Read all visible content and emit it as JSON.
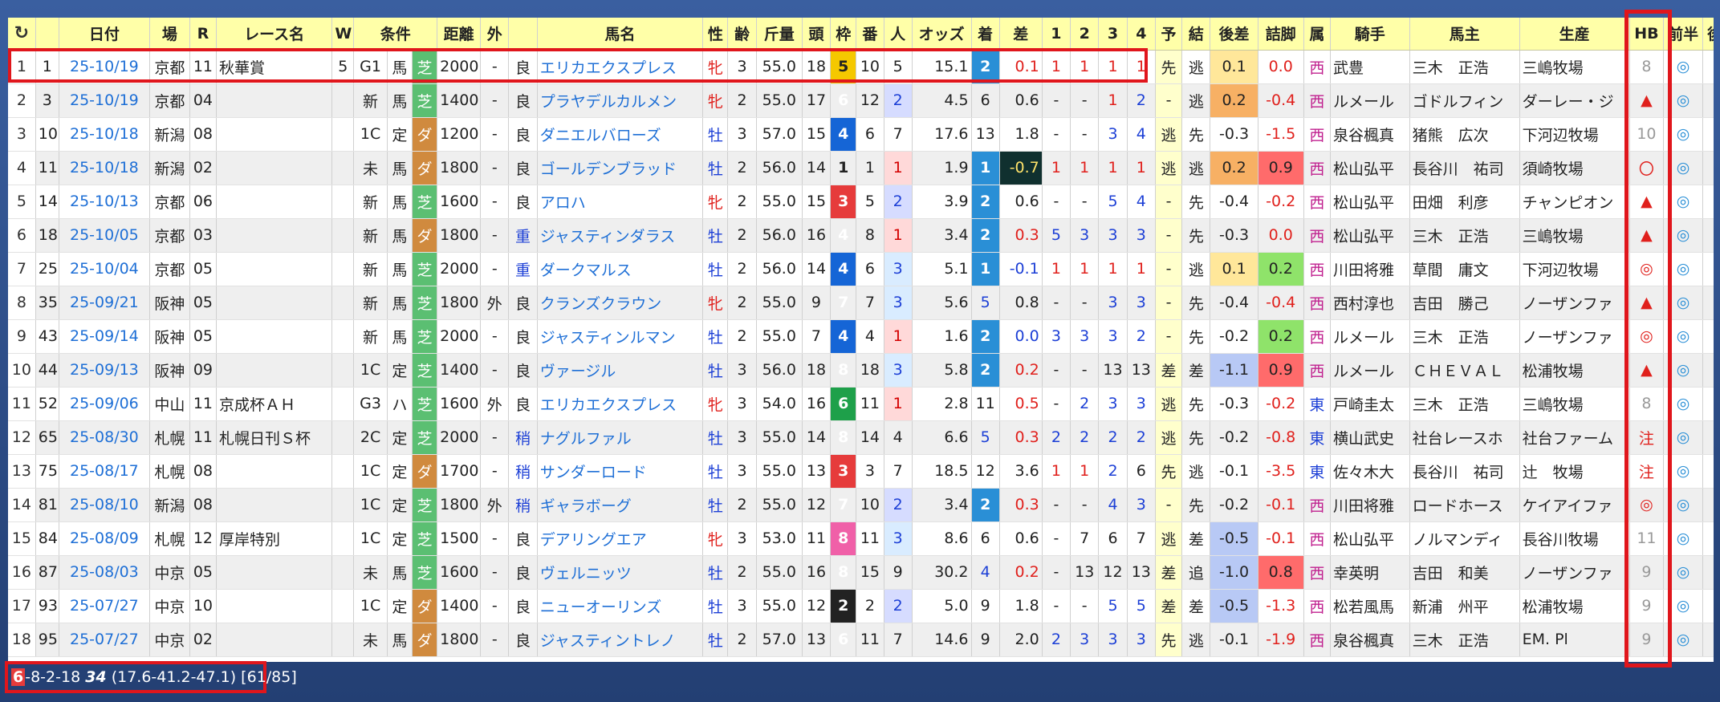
{
  "header": {
    "reload_icon": "reload-icon",
    "columns": [
      "",
      "",
      "日付",
      "場",
      "R",
      "レース名",
      "W",
      "条件",
      "",
      "",
      "距離",
      "外",
      "",
      "馬名",
      "性",
      "齢",
      "斤量",
      "頭",
      "枠",
      "番",
      "人",
      "オッズ",
      "着",
      "差",
      "1",
      "2",
      "3",
      "4",
      "予",
      "結",
      "後差",
      "詰脚",
      "属",
      "騎手",
      "馬主",
      "生産",
      "HB",
      "前半",
      "後半"
    ]
  },
  "rows": [
    {
      "n": "1",
      "no": "1",
      "date": "25-10/19",
      "place": "京都",
      "r": "11",
      "race": "秋華賞",
      "w": "5",
      "cls": "G1",
      "kind": "馬",
      "surf": "芝",
      "dist": "2000",
      "out": "-",
      "cond": "良",
      "horse": "エリカエクスプレス",
      "sex": "牝",
      "age": "3",
      "kin": "55.0",
      "heads": "18",
      "waku": "5",
      "ban": "10",
      "pop": "5",
      "odds": "15.1",
      "chaku": "2",
      "sa": "0.1",
      "c1": "1",
      "c2": "1",
      "c3": "1",
      "c4": "1",
      "yo": "先",
      "ke": "逃",
      "ato": "0.1",
      "tsume": "0.0",
      "zoku": "西",
      "jockey": "武豊",
      "owner": "三木　正浩",
      "breeder": "三嶋牧場",
      "hb": "8",
      "zen": "◎",
      "kou": "-"
    },
    {
      "n": "2",
      "no": "3",
      "date": "25-10/19",
      "place": "京都",
      "r": "04",
      "race": "",
      "w": "",
      "cls": "新",
      "kind": "馬",
      "surf": "芝",
      "dist": "1400",
      "out": "-",
      "cond": "良",
      "horse": "プラヤデルカルメン",
      "sex": "牝",
      "age": "2",
      "kin": "55.0",
      "heads": "17",
      "waku": "6",
      "ban": "12",
      "pop": "2",
      "odds": "4.5",
      "chaku": "6",
      "sa": "0.6",
      "c1": "-",
      "c2": "-",
      "c3": "1",
      "c4": "2",
      "yo": "-",
      "ke": "逃",
      "ato": "0.2",
      "tsume": "-0.4",
      "zoku": "西",
      "jockey": "ルメール",
      "owner": "ゴドルフィン",
      "breeder": "ダーレー・ジ",
      "hb": "▲",
      "zen": "◎",
      "kou": "◎"
    },
    {
      "n": "3",
      "no": "10",
      "date": "25-10/18",
      "place": "新潟",
      "r": "08",
      "race": "",
      "w": "",
      "cls": "1C",
      "kind": "定",
      "surf": "ダ",
      "dist": "1200",
      "out": "-",
      "cond": "良",
      "horse": "ダニエルバローズ",
      "sex": "牡",
      "age": "3",
      "kin": "57.0",
      "heads": "15",
      "waku": "4",
      "ban": "6",
      "pop": "7",
      "odds": "17.6",
      "chaku": "13",
      "sa": "1.8",
      "c1": "-",
      "c2": "-",
      "c3": "3",
      "c4": "4",
      "yo": "逃",
      "ke": "先",
      "ato": "-0.3",
      "tsume": "-1.5",
      "zoku": "西",
      "jockey": "泉谷楓真",
      "owner": "猪熊　広次",
      "breeder": "下河辺牧場",
      "hb": "10",
      "zen": "◎",
      "kou": ""
    },
    {
      "n": "4",
      "no": "11",
      "date": "25-10/18",
      "place": "新潟",
      "r": "02",
      "race": "",
      "w": "",
      "cls": "未",
      "kind": "馬",
      "surf": "ダ",
      "dist": "1800",
      "out": "-",
      "cond": "良",
      "horse": "ゴールデンブラッド",
      "sex": "牡",
      "age": "2",
      "kin": "56.0",
      "heads": "14",
      "waku": "1",
      "ban": "1",
      "pop": "1",
      "odds": "1.9",
      "chaku": "1",
      "sa": "-0.7",
      "c1": "1",
      "c2": "1",
      "c3": "1",
      "c4": "1",
      "yo": "逃",
      "ke": "逃",
      "ato": "0.2",
      "tsume": "0.9",
      "zoku": "西",
      "jockey": "松山弘平",
      "owner": "長谷川　祐司",
      "breeder": "須崎牧場",
      "hb": "〇",
      "zen": "◎",
      "kou": "△"
    },
    {
      "n": "5",
      "no": "14",
      "date": "25-10/13",
      "place": "京都",
      "r": "06",
      "race": "",
      "w": "",
      "cls": "新",
      "kind": "馬",
      "surf": "芝",
      "dist": "1600",
      "out": "-",
      "cond": "良",
      "horse": "アロハ",
      "sex": "牝",
      "age": "2",
      "kin": "55.0",
      "heads": "15",
      "waku": "3",
      "ban": "5",
      "pop": "2",
      "odds": "3.9",
      "chaku": "2",
      "sa": "0.6",
      "c1": "-",
      "c2": "-",
      "c3": "5",
      "c4": "4",
      "yo": "-",
      "ke": "先",
      "ato": "-0.4",
      "tsume": "-0.2",
      "zoku": "西",
      "jockey": "松山弘平",
      "owner": "田畑　利彦",
      "breeder": "チャンピオン",
      "hb": "▲",
      "zen": "◎",
      "kou": ""
    },
    {
      "n": "6",
      "no": "18",
      "date": "25-10/05",
      "place": "京都",
      "r": "03",
      "race": "",
      "w": "",
      "cls": "新",
      "kind": "馬",
      "surf": "ダ",
      "dist": "1800",
      "out": "-",
      "cond": "重",
      "horse": "ジャスティンダラス",
      "sex": "牡",
      "age": "2",
      "kin": "56.0",
      "heads": "16",
      "waku": "4",
      "ban": "8",
      "pop": "1",
      "odds": "3.4",
      "chaku": "2",
      "sa": "0.3",
      "c1": "5",
      "c2": "3",
      "c3": "3",
      "c4": "3",
      "yo": "-",
      "ke": "先",
      "ato": "-0.3",
      "tsume": "0.0",
      "zoku": "西",
      "jockey": "松山弘平",
      "owner": "三木　正浩",
      "breeder": "三嶋牧場",
      "hb": "▲",
      "zen": "◎",
      "kou": ""
    },
    {
      "n": "7",
      "no": "25",
      "date": "25-10/04",
      "place": "京都",
      "r": "05",
      "race": "",
      "w": "",
      "cls": "新",
      "kind": "馬",
      "surf": "芝",
      "dist": "2000",
      "out": "-",
      "cond": "重",
      "horse": "ダークマルス",
      "sex": "牡",
      "age": "2",
      "kin": "56.0",
      "heads": "14",
      "waku": "4",
      "ban": "6",
      "pop": "3",
      "odds": "5.1",
      "chaku": "1",
      "sa": "-0.1",
      "c1": "1",
      "c2": "1",
      "c3": "1",
      "c4": "1",
      "yo": "-",
      "ke": "逃",
      "ato": "0.1",
      "tsume": "0.2",
      "zoku": "西",
      "jockey": "川田将雅",
      "owner": "草間　庸文",
      "breeder": "下河辺牧場",
      "hb": "◎",
      "zen": "◎",
      "kou": ""
    },
    {
      "n": "8",
      "no": "35",
      "date": "25-09/21",
      "place": "阪神",
      "r": "05",
      "race": "",
      "w": "",
      "cls": "新",
      "kind": "馬",
      "surf": "芝",
      "dist": "1800",
      "out": "外",
      "cond": "良",
      "horse": "クランズクラウン",
      "sex": "牝",
      "age": "2",
      "kin": "55.0",
      "heads": "9",
      "waku": "7",
      "ban": "7",
      "pop": "3",
      "odds": "5.6",
      "chaku": "5",
      "sa": "0.8",
      "c1": "-",
      "c2": "-",
      "c3": "3",
      "c4": "3",
      "yo": "-",
      "ke": "先",
      "ato": "-0.4",
      "tsume": "-0.4",
      "zoku": "西",
      "jockey": "西村淳也",
      "owner": "吉田　勝己",
      "breeder": "ノーザンファ",
      "hb": "▲",
      "zen": "◎",
      "kou": ""
    },
    {
      "n": "9",
      "no": "43",
      "date": "25-09/14",
      "place": "阪神",
      "r": "05",
      "race": "",
      "w": "",
      "cls": "新",
      "kind": "馬",
      "surf": "芝",
      "dist": "2000",
      "out": "-",
      "cond": "良",
      "horse": "ジャスティンルマン",
      "sex": "牡",
      "age": "2",
      "kin": "55.0",
      "heads": "7",
      "waku": "4",
      "ban": "4",
      "pop": "1",
      "odds": "1.6",
      "chaku": "2",
      "sa": "0.0",
      "c1": "3",
      "c2": "3",
      "c3": "3",
      "c4": "2",
      "yo": "-",
      "ke": "先",
      "ato": "-0.2",
      "tsume": "0.2",
      "zoku": "西",
      "jockey": "ルメール",
      "owner": "三木　正浩",
      "breeder": "ノーザンファ",
      "hb": "◎",
      "zen": "◎",
      "kou": ""
    },
    {
      "n": "10",
      "no": "44",
      "date": "25-09/13",
      "place": "阪神",
      "r": "09",
      "race": "",
      "w": "",
      "cls": "1C",
      "kind": "定",
      "surf": "芝",
      "dist": "1400",
      "out": "-",
      "cond": "良",
      "horse": "ヴァージル",
      "sex": "牡",
      "age": "3",
      "kin": "56.0",
      "heads": "18",
      "waku": "8",
      "ban": "18",
      "pop": "3",
      "odds": "5.8",
      "chaku": "2",
      "sa": "0.2",
      "c1": "-",
      "c2": "-",
      "c3": "13",
      "c4": "13",
      "yo": "差",
      "ke": "差",
      "ato": "-1.1",
      "tsume": "0.9",
      "zoku": "西",
      "jockey": "ルメール",
      "owner": "ＣＨＥＶＡＬ",
      "breeder": "松浦牧場",
      "hb": "▲",
      "zen": "◎",
      "kou": ""
    },
    {
      "n": "11",
      "no": "52",
      "date": "25-09/06",
      "place": "中山",
      "r": "11",
      "race": "京成杯ＡＨ",
      "w": "",
      "cls": "G3",
      "kind": "ハ",
      "surf": "芝",
      "dist": "1600",
      "out": "外",
      "cond": "良",
      "horse": "エリカエクスプレス",
      "sex": "牝",
      "age": "3",
      "kin": "54.0",
      "heads": "16",
      "waku": "6",
      "ban": "11",
      "pop": "1",
      "odds": "2.8",
      "chaku": "11",
      "sa": "0.5",
      "c1": "-",
      "c2": "2",
      "c3": "3",
      "c4": "3",
      "yo": "逃",
      "ke": "先",
      "ato": "-0.3",
      "tsume": "-0.2",
      "zoku": "東",
      "jockey": "戸崎圭太",
      "owner": "三木　正浩",
      "breeder": "三嶋牧場",
      "hb": "8",
      "zen": "◎",
      "kou": ""
    },
    {
      "n": "12",
      "no": "65",
      "date": "25-08/30",
      "place": "札幌",
      "r": "11",
      "race": "札幌日刊Ｓ杯",
      "w": "",
      "cls": "2C",
      "kind": "定",
      "surf": "芝",
      "dist": "2000",
      "out": "-",
      "cond": "稍",
      "horse": "ナグルファル",
      "sex": "牡",
      "age": "3",
      "kin": "55.0",
      "heads": "14",
      "waku": "8",
      "ban": "14",
      "pop": "4",
      "odds": "6.6",
      "chaku": "5",
      "sa": "0.3",
      "c1": "2",
      "c2": "2",
      "c3": "2",
      "c4": "2",
      "yo": "逃",
      "ke": "先",
      "ato": "-0.2",
      "tsume": "-0.8",
      "zoku": "東",
      "jockey": "横山武史",
      "owner": "社台レースホ",
      "breeder": "社台ファーム",
      "hb": "注",
      "zen": "◎",
      "kou": ""
    },
    {
      "n": "13",
      "no": "75",
      "date": "25-08/17",
      "place": "札幌",
      "r": "08",
      "race": "",
      "w": "",
      "cls": "1C",
      "kind": "定",
      "surf": "ダ",
      "dist": "1700",
      "out": "-",
      "cond": "稍",
      "horse": "サンダーロード",
      "sex": "牡",
      "age": "3",
      "kin": "55.0",
      "heads": "13",
      "waku": "3",
      "ban": "3",
      "pop": "7",
      "odds": "18.5",
      "chaku": "12",
      "sa": "3.6",
      "c1": "1",
      "c2": "1",
      "c3": "2",
      "c4": "6",
      "yo": "先",
      "ke": "逃",
      "ato": "-0.1",
      "tsume": "-3.5",
      "zoku": "東",
      "jockey": "佐々木大",
      "owner": "長谷川　祐司",
      "breeder": "辻　牧場",
      "hb": "注",
      "zen": "◎",
      "kou": ""
    },
    {
      "n": "14",
      "no": "81",
      "date": "25-08/10",
      "place": "新潟",
      "r": "08",
      "race": "",
      "w": "",
      "cls": "1C",
      "kind": "定",
      "surf": "芝",
      "dist": "1800",
      "out": "外",
      "cond": "稍",
      "horse": "ギャラボーグ",
      "sex": "牡",
      "age": "2",
      "kin": "55.0",
      "heads": "12",
      "waku": "7",
      "ban": "10",
      "pop": "2",
      "odds": "3.4",
      "chaku": "2",
      "sa": "0.3",
      "c1": "-",
      "c2": "-",
      "c3": "4",
      "c4": "3",
      "yo": "-",
      "ke": "先",
      "ato": "-0.2",
      "tsume": "-0.1",
      "zoku": "西",
      "jockey": "川田将雅",
      "owner": "ロードホース",
      "breeder": "ケイアイファ",
      "hb": "◎",
      "zen": "◎",
      "kou": ""
    },
    {
      "n": "15",
      "no": "84",
      "date": "25-08/09",
      "place": "札幌",
      "r": "12",
      "race": "厚岸特別",
      "w": "",
      "cls": "1C",
      "kind": "定",
      "surf": "芝",
      "dist": "1500",
      "out": "-",
      "cond": "良",
      "horse": "デアリングエア",
      "sex": "牝",
      "age": "3",
      "kin": "53.0",
      "heads": "11",
      "waku": "8",
      "ban": "11",
      "pop": "3",
      "odds": "8.6",
      "chaku": "6",
      "sa": "0.6",
      "c1": "-",
      "c2": "7",
      "c3": "6",
      "c4": "7",
      "yo": "逃",
      "ke": "差",
      "ato": "-0.5",
      "tsume": "-0.1",
      "zoku": "西",
      "jockey": "松山弘平",
      "owner": "ノルマンディ",
      "breeder": "長谷川牧場",
      "hb": "11",
      "zen": "◎",
      "kou": ""
    },
    {
      "n": "16",
      "no": "87",
      "date": "25-08/03",
      "place": "中京",
      "r": "05",
      "race": "",
      "w": "",
      "cls": "未",
      "kind": "馬",
      "surf": "芝",
      "dist": "1600",
      "out": "-",
      "cond": "良",
      "horse": "ヴェルニッツ",
      "sex": "牡",
      "age": "2",
      "kin": "55.0",
      "heads": "16",
      "waku": "8",
      "ban": "15",
      "pop": "9",
      "odds": "30.2",
      "chaku": "4",
      "sa": "0.2",
      "c1": "-",
      "c2": "13",
      "c3": "12",
      "c4": "13",
      "yo": "差",
      "ke": "追",
      "ato": "-1.0",
      "tsume": "0.8",
      "zoku": "西",
      "jockey": "幸英明",
      "owner": "吉田　和美",
      "breeder": "ノーザンファ",
      "hb": "9",
      "zen": "◎",
      "kou": ""
    },
    {
      "n": "17",
      "no": "93",
      "date": "25-07/27",
      "place": "中京",
      "r": "10",
      "race": "",
      "w": "",
      "cls": "1C",
      "kind": "定",
      "surf": "ダ",
      "dist": "1400",
      "out": "-",
      "cond": "良",
      "horse": "ニューオーリンズ",
      "sex": "牡",
      "age": "3",
      "kin": "55.0",
      "heads": "12",
      "waku": "2",
      "ban": "2",
      "pop": "2",
      "odds": "5.0",
      "chaku": "9",
      "sa": "1.8",
      "c1": "-",
      "c2": "-",
      "c3": "5",
      "c4": "5",
      "yo": "差",
      "ke": "差",
      "ato": "-0.5",
      "tsume": "-1.3",
      "zoku": "西",
      "jockey": "松若風馬",
      "owner": "新浦　州平",
      "breeder": "松浦牧場",
      "hb": "9",
      "zen": "◎",
      "kou": ""
    },
    {
      "n": "18",
      "no": "95",
      "date": "25-07/27",
      "place": "中京",
      "r": "02",
      "race": "",
      "w": "",
      "cls": "未",
      "kind": "馬",
      "surf": "ダ",
      "dist": "1800",
      "out": "-",
      "cond": "良",
      "horse": "ジャスティントレノ",
      "sex": "牡",
      "age": "2",
      "kin": "57.0",
      "heads": "13",
      "waku": "6",
      "ban": "11",
      "pop": "7",
      "odds": "14.6",
      "chaku": "9",
      "sa": "2.0",
      "c1": "2",
      "c2": "3",
      "c3": "3",
      "c4": "3",
      "yo": "先",
      "ke": "逃",
      "ato": "-0.1",
      "tsume": "-1.9",
      "zoku": "西",
      "jockey": "泉谷楓真",
      "owner": "三木　正浩",
      "breeder": "EM. Pl",
      "hb": "9",
      "zen": "◎",
      "kou": ""
    }
  ],
  "status": {
    "waku": "6",
    "rest": "-8-2-18 ",
    "bold": "34",
    "tail": " (17.6-41.2-47.1) [61/85]"
  },
  "colors": {
    "highlight_border": "#e0161c",
    "header_bg": "#ffffa8",
    "turf": "#5bbf72",
    "dirt": "#d08a3e",
    "win": "#2a8fd6"
  }
}
